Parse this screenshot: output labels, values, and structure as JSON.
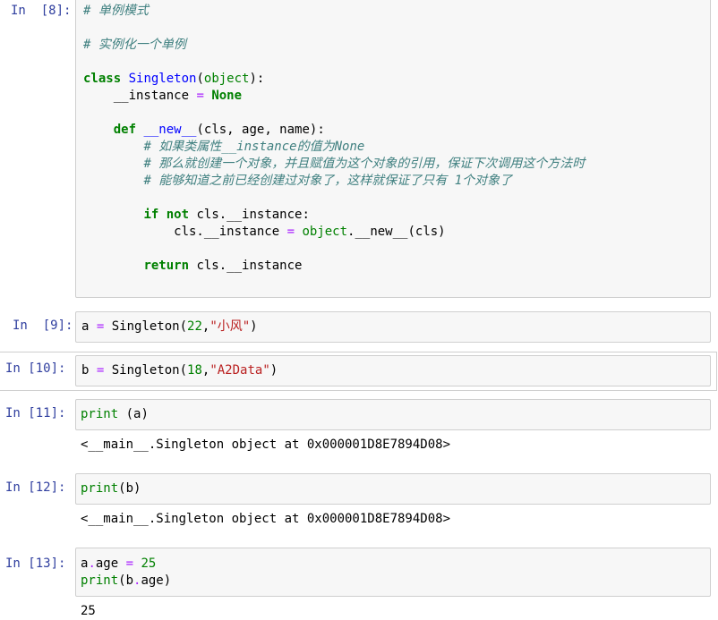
{
  "cells": [
    {
      "prompt": "In  [8]:",
      "lines": [
        [
          {
            "t": "# 单例模式",
            "c": "cm"
          }
        ],
        [],
        [
          {
            "t": "# 实例化一个单例",
            "c": "cm"
          }
        ],
        [],
        [
          {
            "t": "class",
            "c": "kw"
          },
          {
            "t": " "
          },
          {
            "t": "Singleton",
            "c": "fn"
          },
          {
            "t": "("
          },
          {
            "t": "object",
            "c": "bi"
          },
          {
            "t": "):"
          }
        ],
        [
          {
            "t": "    __instance "
          },
          {
            "t": "=",
            "c": "op"
          },
          {
            "t": " "
          },
          {
            "t": "None",
            "c": "kw"
          }
        ],
        [],
        [
          {
            "t": "    "
          },
          {
            "t": "def",
            "c": "kw"
          },
          {
            "t": " "
          },
          {
            "t": "__new__",
            "c": "fn"
          },
          {
            "t": "(cls, age, name):"
          }
        ],
        [
          {
            "t": "        "
          },
          {
            "t": "# 如果类属性__instance的值为None",
            "c": "cm"
          }
        ],
        [
          {
            "t": "        "
          },
          {
            "t": "# 那么就创建一个对象，并且赋值为这个对象的引用，保证下次调用这个方法时",
            "c": "cm"
          }
        ],
        [
          {
            "t": "        "
          },
          {
            "t": "# 能够知道之前已经创建过对象了，这样就保证了只有 1个对象了",
            "c": "cm"
          }
        ],
        [],
        [
          {
            "t": "        "
          },
          {
            "t": "if",
            "c": "kw"
          },
          {
            "t": " "
          },
          {
            "t": "not",
            "c": "kw"
          },
          {
            "t": " cls.__instance:"
          }
        ],
        [
          {
            "t": "            cls.__instance "
          },
          {
            "t": "=",
            "c": "op"
          },
          {
            "t": " "
          },
          {
            "t": "object",
            "c": "bi"
          },
          {
            "t": ".__new__(cls)"
          }
        ],
        [],
        [
          {
            "t": "        "
          },
          {
            "t": "return",
            "c": "kw"
          },
          {
            "t": " cls.__instance"
          }
        ]
      ],
      "output": ""
    },
    {
      "prompt": "In  [9]:",
      "lines": [
        [
          {
            "t": "a "
          },
          {
            "t": "=",
            "c": "op"
          },
          {
            "t": " Singleton("
          },
          {
            "t": "22",
            "c": "num"
          },
          {
            "t": ","
          },
          {
            "t": "\"小风\"",
            "c": "str"
          },
          {
            "t": ")"
          }
        ]
      ],
      "output": ""
    },
    {
      "prompt": "In [10]:",
      "lines": [
        [
          {
            "t": "b "
          },
          {
            "t": "=",
            "c": "op"
          },
          {
            "t": " Singleton("
          },
          {
            "t": "18",
            "c": "num"
          },
          {
            "t": ","
          },
          {
            "t": "\"A2Data\"",
            "c": "str"
          },
          {
            "t": ")"
          }
        ]
      ],
      "output": ""
    },
    {
      "prompt": "In [11]:",
      "lines": [
        [
          {
            "t": "print",
            "c": "bi"
          },
          {
            "t": " (a)"
          }
        ]
      ],
      "output": "<__main__.Singleton object at 0x000001D8E7894D08>"
    },
    {
      "prompt": "In [12]:",
      "lines": [
        [
          {
            "t": "print",
            "c": "bi"
          },
          {
            "t": "(b)"
          }
        ]
      ],
      "output": "<__main__.Singleton object at 0x000001D8E7894D08>"
    },
    {
      "prompt": "In [13]:",
      "lines": [
        [
          {
            "t": "a"
          },
          {
            "t": ".",
            "c": "op"
          },
          {
            "t": "age "
          },
          {
            "t": "=",
            "c": "op"
          },
          {
            "t": " "
          },
          {
            "t": "25",
            "c": "num"
          }
        ],
        [
          {
            "t": "print",
            "c": "bi"
          },
          {
            "t": "(b"
          },
          {
            "t": ".",
            "c": "op"
          },
          {
            "t": "age)"
          }
        ]
      ],
      "output": "25"
    }
  ]
}
